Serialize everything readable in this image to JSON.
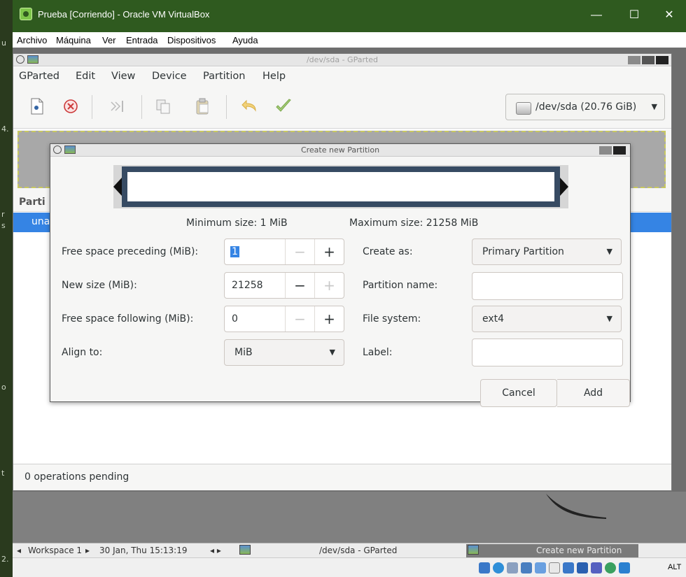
{
  "host": {
    "left_fragments": [
      "u",
      "4.",
      "r",
      "s",
      "o",
      "t",
      "2."
    ]
  },
  "vbox": {
    "title": "Prueba [Corriendo] - Oracle VM VirtualBox",
    "minimize": "—",
    "maximize": "☐",
    "close": "✕",
    "menu": [
      "Archivo",
      "Máquina",
      "Ver",
      "Entrada",
      "Dispositivos",
      "Ayuda"
    ]
  },
  "gparted": {
    "window_title": "/dev/sda - GParted",
    "menu": [
      "GParted",
      "Edit",
      "View",
      "Device",
      "Partition",
      "Help"
    ],
    "device_selector": "/dev/sda  (20.76 GiB)",
    "partition_header": "Parti",
    "selected_row": "una",
    "status": "0 operations pending"
  },
  "dialog": {
    "title": "Create new Partition",
    "min_size": "Minimum size: 1 MiB",
    "max_size": "Maximum size: 21258 MiB",
    "free_preceding_label": "Free space preceding (MiB):",
    "free_preceding_value": "1",
    "new_size_label": "New size (MiB):",
    "new_size_value": "21258",
    "free_following_label": "Free space following (MiB):",
    "free_following_value": "0",
    "align_label": "Align to:",
    "align_value": "MiB",
    "create_as_label": "Create as:",
    "create_as_value": "Primary Partition",
    "partition_name_label": "Partition name:",
    "partition_name_value": "",
    "file_system_label": "File system:",
    "file_system_value": "ext4",
    "label_label": "Label:",
    "label_value": "",
    "minus": "−",
    "plus": "+",
    "cancel": "Cancel",
    "add": "Add"
  },
  "panel": {
    "workspace_prev": "◂",
    "workspace": "Workspace 1",
    "workspace_next": "▸",
    "clock": "30 Jan, Thu 15:13:19",
    "arrows": "◂  ▸",
    "task1": "/dev/sda - GParted",
    "task2": "Create new Partition"
  },
  "statusbar": {
    "alt": "ALT"
  },
  "colors": {
    "vbox_title_bg": "#2f5a1f",
    "selection": "#3584e4",
    "resizer_frame": "#374b63"
  }
}
